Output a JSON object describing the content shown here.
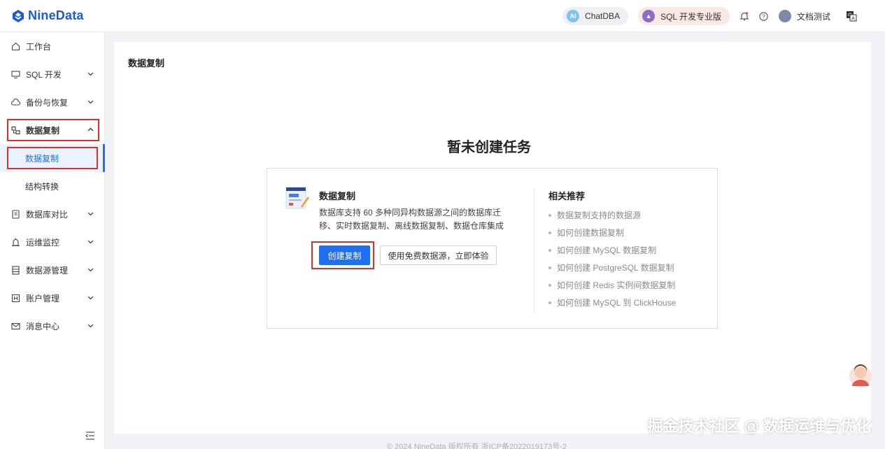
{
  "header": {
    "logo_text": "NineData",
    "chatdba_label": "ChatDBA",
    "sql_label": "SQL 开发专业版",
    "user_name": "文档测试",
    "icons": [
      "bell-icon",
      "help-icon",
      "language-icon"
    ]
  },
  "sidebar": {
    "items": [
      {
        "label": "工作台",
        "icon": "home-icon"
      },
      {
        "label": "SQL 开发",
        "icon": "monitor-icon"
      },
      {
        "label": "备份与恢复",
        "icon": "cloud-icon"
      },
      {
        "label": "数据复制",
        "icon": "replication-icon"
      },
      {
        "label": "数据复制"
      },
      {
        "label": "结构转换"
      },
      {
        "label": "数据库对比",
        "icon": "compare-icon"
      },
      {
        "label": "运维监控",
        "icon": "alarm-icon"
      },
      {
        "label": "数据源管理",
        "icon": "datasource-icon"
      },
      {
        "label": "账户管理",
        "icon": "account-icon"
      },
      {
        "label": "消息中心",
        "icon": "mail-icon"
      }
    ]
  },
  "main": {
    "page_title": "数据复制",
    "empty_title": "暂未创建任务",
    "card": {
      "title": "数据复制",
      "description": "数据库支持 60 多种同异构数据源之间的数据库迁移、实时数据复制、离线数据复制、数据仓库集成",
      "primary_button": "创建复制",
      "secondary_button": "使用免费数据源，立即体验"
    },
    "recommend": {
      "title": "相关推荐",
      "links": [
        "数据复制支持的数据源",
        "如何创建数据复制",
        "如何创建 MySQL 数据复制",
        "如何创建 PostgreSQL 数据复制",
        "如何创建 Redis 实例间数据复制",
        "如何创建 MySQL 到 ClickHouse"
      ]
    }
  },
  "footer": {
    "copyright": "© 2024 NineData 版权所有 浙ICP备2022019173号-2"
  },
  "watermark": "掘金技术社区 @ 数据运维与优化",
  "colors": {
    "brand": "#1a5cd7",
    "primary": "#1e6ff2",
    "highlight_box": "#d9302c"
  }
}
